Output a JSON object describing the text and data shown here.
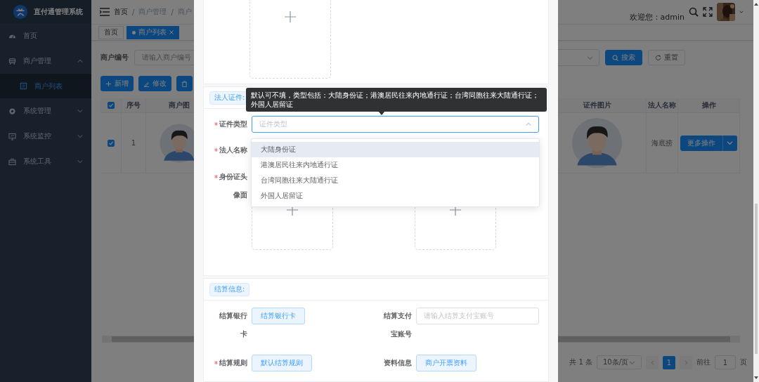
{
  "sidebar": {
    "title": "直付通管理系统",
    "items": [
      {
        "label": "首页",
        "selected": false
      },
      {
        "label": "商户管理",
        "selected": false,
        "expanded": true,
        "children": [
          {
            "label": "商户列表",
            "selected": true
          }
        ]
      },
      {
        "label": "系统管理",
        "selected": false,
        "expanded": false
      },
      {
        "label": "系统监控",
        "selected": false,
        "expanded": false
      },
      {
        "label": "系统工具",
        "selected": false,
        "expanded": false
      }
    ]
  },
  "header": {
    "breadcrumb": [
      "首页",
      "商户管理",
      "商户"
    ],
    "separator": "/",
    "welcome": "欢迎您：admin"
  },
  "tags": [
    {
      "label": "首页",
      "selected": false
    },
    {
      "label": "商户列表",
      "selected": true
    }
  ],
  "search": {
    "label": "商户编号",
    "placeholder": "请输入商户编号",
    "buttons": [
      "搜索",
      "重置"
    ]
  },
  "toolbar": [
    {
      "label": "新增"
    },
    {
      "label": "修改"
    }
  ],
  "table": {
    "all_checked": true,
    "columns": [
      "序号",
      "商户图",
      "证件图片",
      "法人名称",
      "操作"
    ],
    "rows": [
      {
        "checked": true,
        "index": "1",
        "legal_name": "海底捞",
        "action": "更多操作"
      }
    ]
  },
  "pagination": {
    "total": "共 1 条",
    "page_size": "10条/页",
    "pages": [
      {
        "label": "1",
        "selected": true
      }
    ],
    "goto_label": "前往",
    "goto_value": "1",
    "goto_suffix": "页"
  },
  "dialog": {
    "legal": {
      "tag": "法人证件:",
      "tooltip": "默认可不填，类型包括：大陆身份证；港澳居民往来内地通行证；台湾同胞往来大陆通行证；外国人居留证",
      "fields": [
        {
          "kind": "select",
          "label": "证件类型",
          "required": true,
          "placeholder": "证件类型",
          "open": true,
          "options": [
            {
              "label": "大陆身份证",
              "highlighted": true
            },
            {
              "label": "港澳居民往来内地通行证",
              "highlighted": false
            },
            {
              "label": "台湾同胞往来大陆通行证",
              "highlighted": false
            },
            {
              "label": "外国人居留证",
              "highlighted": false
            }
          ]
        },
        {
          "kind": "label_only",
          "label": "法人名称",
          "required": true
        },
        {
          "kind": "upload",
          "label": "身份证头像面",
          "required": true
        }
      ]
    },
    "settlement": {
      "tag": "结算信息:",
      "fields": [
        {
          "kind": "button",
          "label": "结算银行卡",
          "required": false,
          "value": "结算银行卡"
        },
        {
          "kind": "input",
          "label": "结算支付宝账号",
          "required": false,
          "placeholder": "请输入结算支付宝账号"
        },
        {
          "kind": "button",
          "label": "结算规则",
          "required": true,
          "value": "默认结算规则"
        },
        {
          "kind": "button",
          "label": "资料信息",
          "required": false,
          "value": "商户开票资料"
        }
      ]
    }
  }
}
